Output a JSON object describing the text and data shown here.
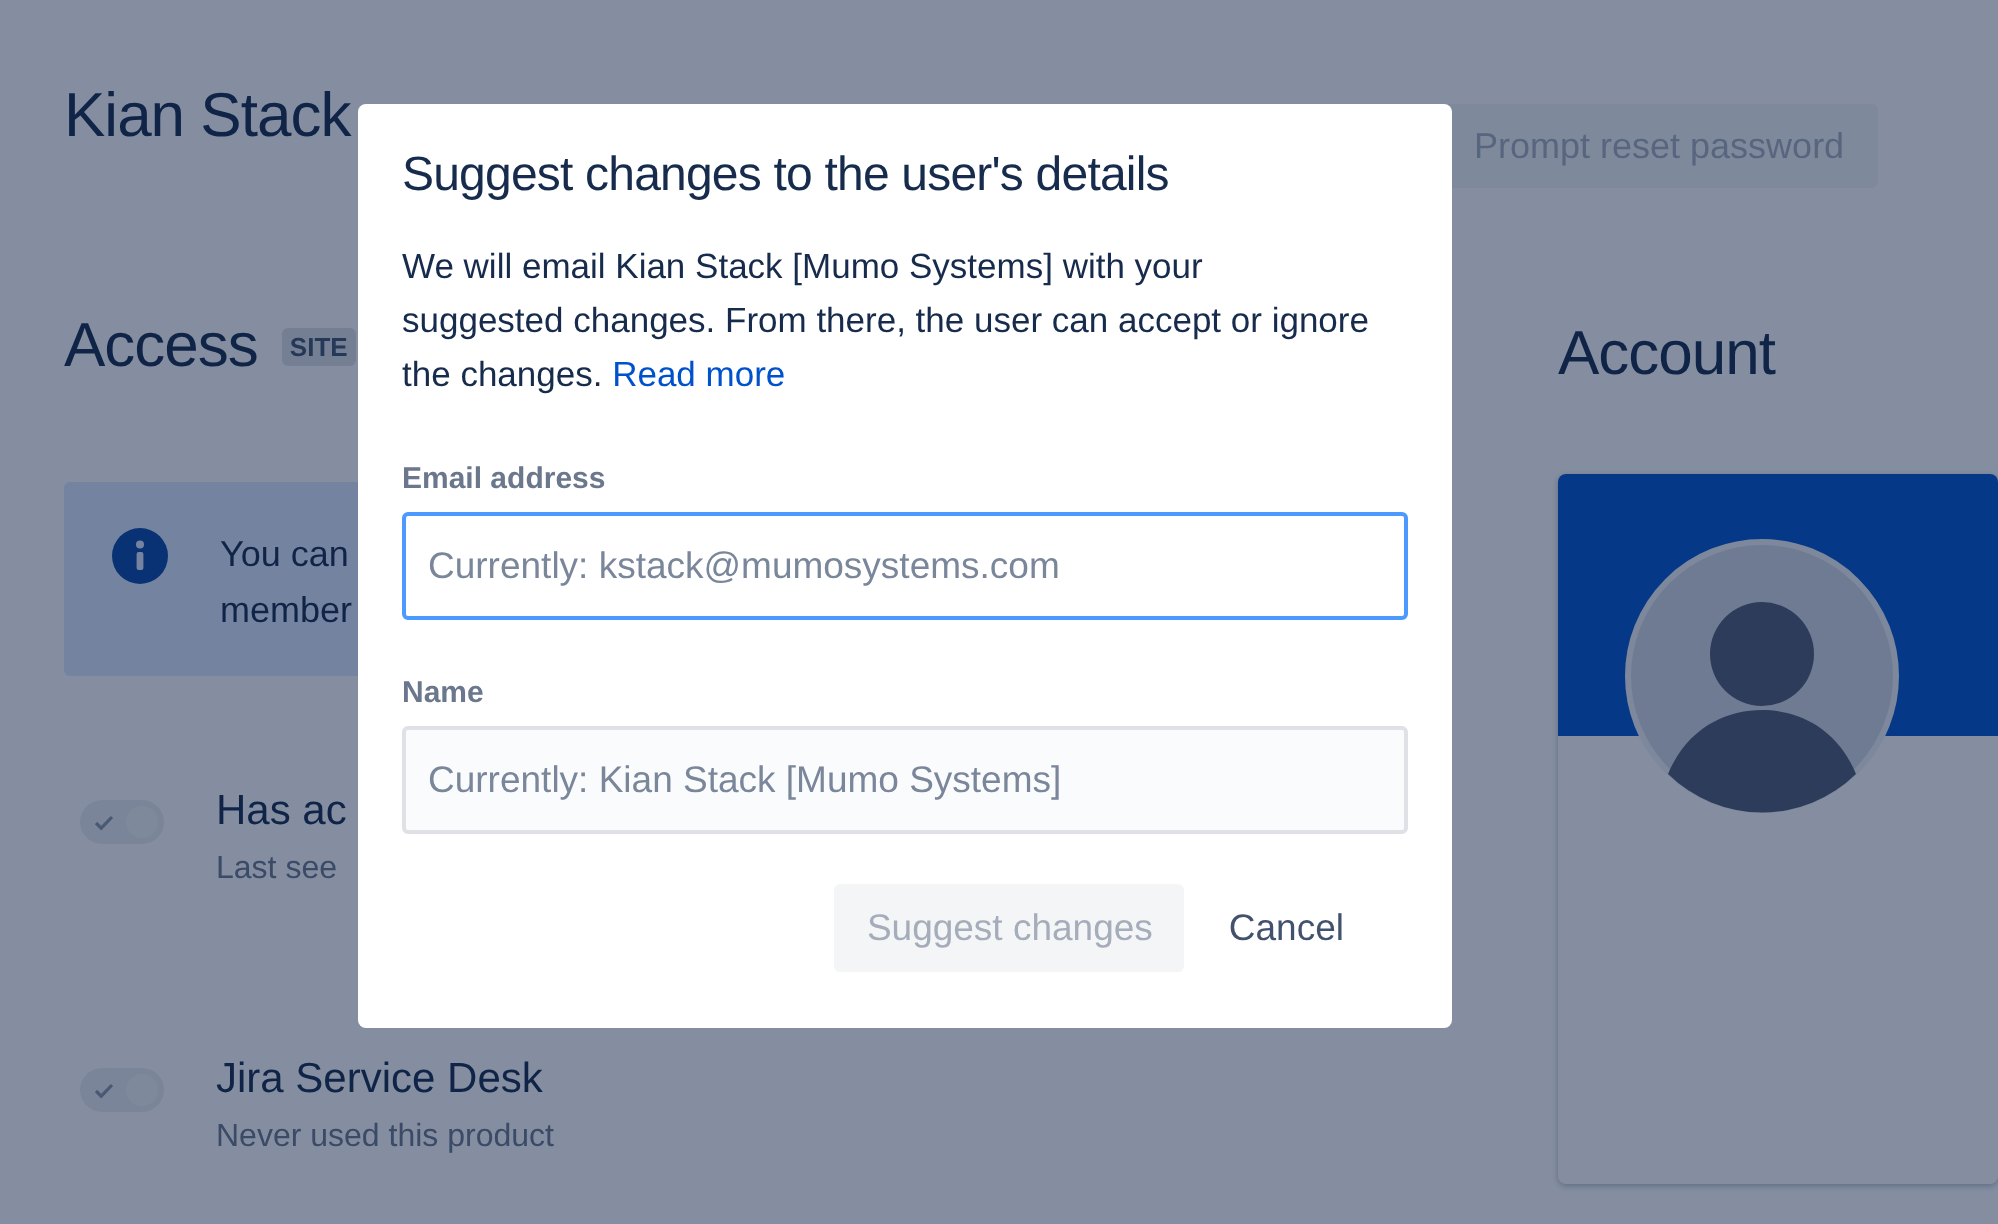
{
  "page": {
    "title": "Kian Stack",
    "header_buttons": [
      "Prompt reset password"
    ],
    "access": {
      "heading": "Access",
      "badge": "SITE",
      "info": {
        "lines": [
          "You can",
          "member"
        ]
      },
      "products": [
        {
          "name": "Has ac",
          "detail": "Last see",
          "on": true
        },
        {
          "name": "Jira Service Desk",
          "detail": "Never used this product",
          "on": true
        }
      ]
    },
    "account": {
      "heading": "Account"
    }
  },
  "dialog": {
    "title": "Suggest changes to the user's details",
    "body": "We will email Kian Stack [Mumo Systems] with your suggested changes. From there, the user can accept or ignore the changes.",
    "link": "Read more",
    "fields": [
      {
        "label": "Email address",
        "placeholder": "Currently: kstack@mumosystems.com",
        "focused": true
      },
      {
        "label": "Name",
        "placeholder": "Currently: Kian Stack [Mumo Systems]",
        "focused": false
      }
    ],
    "buttons": [
      {
        "label": "Suggest changes",
        "kind": "primary",
        "disabled": true
      },
      {
        "label": "Cancel",
        "kind": "subtle",
        "disabled": false
      }
    ]
  }
}
